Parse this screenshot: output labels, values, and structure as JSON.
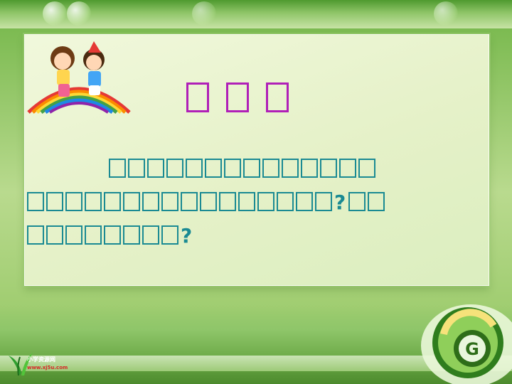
{
  "slide": {
    "title_glyphs": [
      "□",
      "□",
      "□"
    ],
    "paragraph_line1_glyph_count": 14,
    "paragraph_line2_glyph_count": 16,
    "paragraph_line2_after_q_count": 2,
    "paragraph_line3_glyph_count": 8,
    "question_mark": "?"
  },
  "logo": {
    "name": "小学资源网",
    "url": "www.xj5u.com"
  },
  "colors": {
    "title_accent": "#b01fb8",
    "text": "#1a8a93",
    "background": "#9ccb6c"
  }
}
